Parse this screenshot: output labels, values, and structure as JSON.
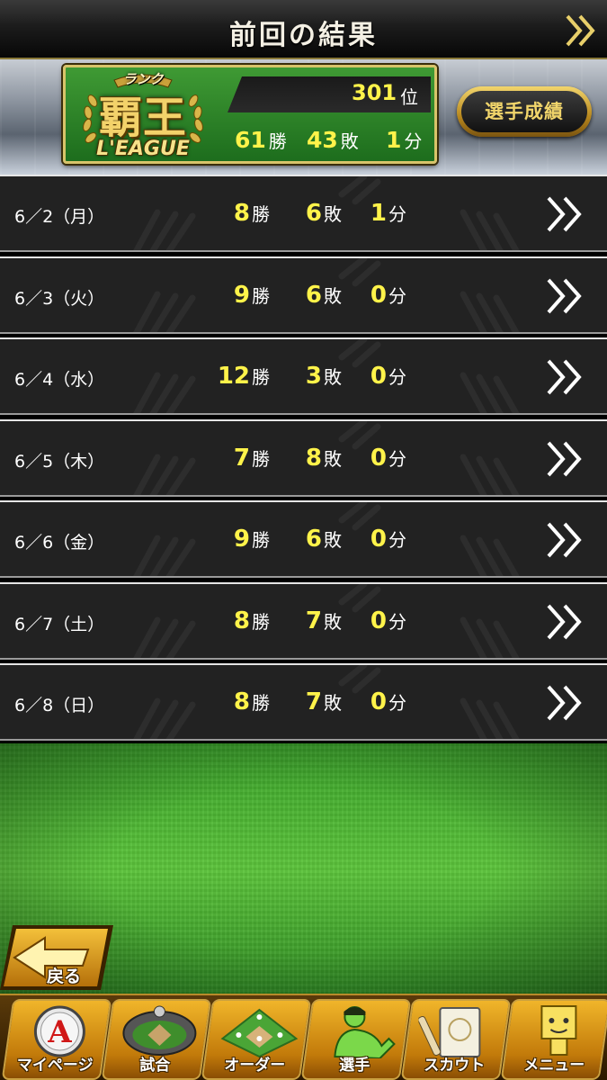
{
  "header": {
    "title": "前回の結果"
  },
  "rank_panel": {
    "emblem_rank_label": "ランク",
    "emblem_title": "覇王",
    "emblem_league": "L'EAGUE",
    "rank_number": "301",
    "rank_unit": "位",
    "total": {
      "wins": "61",
      "losses": "43",
      "draws": "1"
    },
    "stats_button_label": "選手成績"
  },
  "units": {
    "win": "勝",
    "loss": "敗",
    "draw": "分"
  },
  "days": [
    {
      "date": "6／2（月）",
      "wins": "8",
      "losses": "6",
      "draws": "1"
    },
    {
      "date": "6／3（火）",
      "wins": "9",
      "losses": "6",
      "draws": "0"
    },
    {
      "date": "6／4（水）",
      "wins": "12",
      "losses": "3",
      "draws": "0"
    },
    {
      "date": "6／5（木）",
      "wins": "7",
      "losses": "8",
      "draws": "0"
    },
    {
      "date": "6／6（金）",
      "wins": "9",
      "losses": "6",
      "draws": "0"
    },
    {
      "date": "6／7（土）",
      "wins": "8",
      "losses": "7",
      "draws": "0"
    },
    {
      "date": "6／8（日）",
      "wins": "8",
      "losses": "7",
      "draws": "0"
    }
  ],
  "back_button_label": "戻る",
  "bottom_nav": [
    {
      "label": "マイページ",
      "icon": "mypage-icon"
    },
    {
      "label": "試合",
      "icon": "stadium-icon"
    },
    {
      "label": "オーダー",
      "icon": "order-field-icon"
    },
    {
      "label": "選手",
      "icon": "player-icon"
    },
    {
      "label": "スカウト",
      "icon": "scout-card-icon"
    },
    {
      "label": "メニュー",
      "icon": "menu-character-icon"
    }
  ],
  "colors": {
    "accent_yellow": "#fff34a",
    "gold": "#d8c46a",
    "field_green": "#4db432",
    "row_bg": "#222222"
  }
}
